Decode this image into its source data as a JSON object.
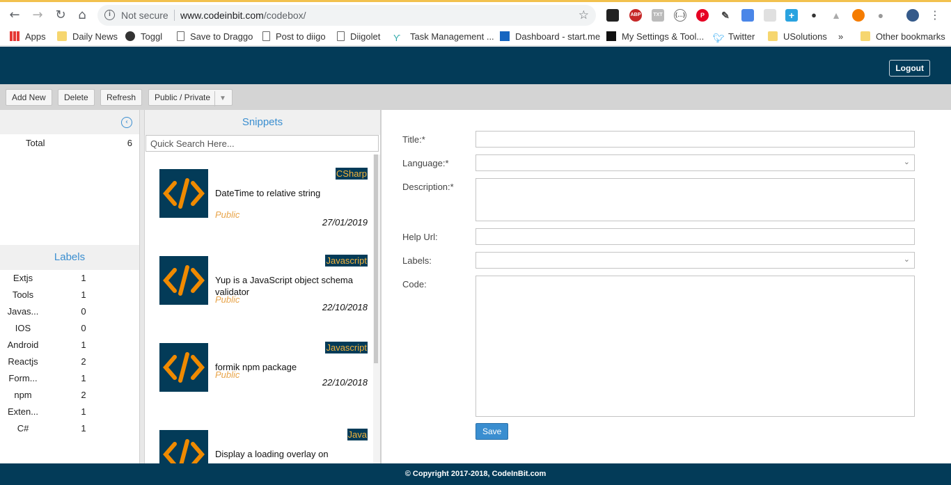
{
  "browser": {
    "security_text": "Not secure",
    "url_host": "www.codeinbit.com",
    "url_path": "/codebox/",
    "bookmarks": [
      {
        "label": "Apps"
      },
      {
        "label": "Daily News"
      },
      {
        "label": "Toggl"
      },
      {
        "label": "Save to Draggo"
      },
      {
        "label": "Post to diigo"
      },
      {
        "label": "Diigolet"
      },
      {
        "label": "Task Management ..."
      },
      {
        "label": "Dashboard - start.me"
      },
      {
        "label": "My Settings & Tool..."
      },
      {
        "label": "Twitter"
      },
      {
        "label": "USolutions"
      },
      {
        "label": "»"
      },
      {
        "label": "Other bookmarks"
      }
    ],
    "extensions": [
      "ABP",
      "TXT",
      "{…}",
      "P"
    ]
  },
  "header": {
    "logout_label": "Logout",
    "brand_color": "#033b58"
  },
  "toolbar": {
    "add_new": "Add New",
    "delete": "Delete",
    "refresh": "Refresh",
    "visibility": "Public / Private"
  },
  "left": {
    "total_label": "Total",
    "total_count": "6",
    "labels_title": "Labels",
    "labels": [
      {
        "name": "Extjs",
        "count": "1"
      },
      {
        "name": "Tools",
        "count": "1"
      },
      {
        "name": "Javas...",
        "count": "0"
      },
      {
        "name": "IOS",
        "count": "0"
      },
      {
        "name": "Android",
        "count": "1"
      },
      {
        "name": "Reactjs",
        "count": "2"
      },
      {
        "name": "Form...",
        "count": "1"
      },
      {
        "name": "npm",
        "count": "2"
      },
      {
        "name": "Exten...",
        "count": "1"
      },
      {
        "name": "C#",
        "count": "1"
      }
    ]
  },
  "snippets": {
    "title": "Snippets",
    "search_placeholder": "Quick Search Here...",
    "items": [
      {
        "lang": "CSharp",
        "title": "DateTime to relative string",
        "visibility": "Public",
        "date": "27/01/2019"
      },
      {
        "lang": "Javascript",
        "title": "Yup is a JavaScript object schema validator",
        "visibility": "Public",
        "date": "22/10/2018"
      },
      {
        "lang": "Javascript",
        "title": "formik npm package",
        "visibility": "Public",
        "date": "22/10/2018"
      },
      {
        "lang": "Java",
        "title": "Display a loading overlay on",
        "visibility": "",
        "date": ""
      }
    ]
  },
  "form": {
    "title_label": "Title:*",
    "language_label": "Language:*",
    "description_label": "Description:*",
    "help_url_label": "Help Url:",
    "labels_label": "Labels:",
    "code_label": "Code:",
    "save_label": "Save"
  },
  "footer": {
    "copyright": "© Copyright 2017-2018, CodeInBit.com"
  }
}
